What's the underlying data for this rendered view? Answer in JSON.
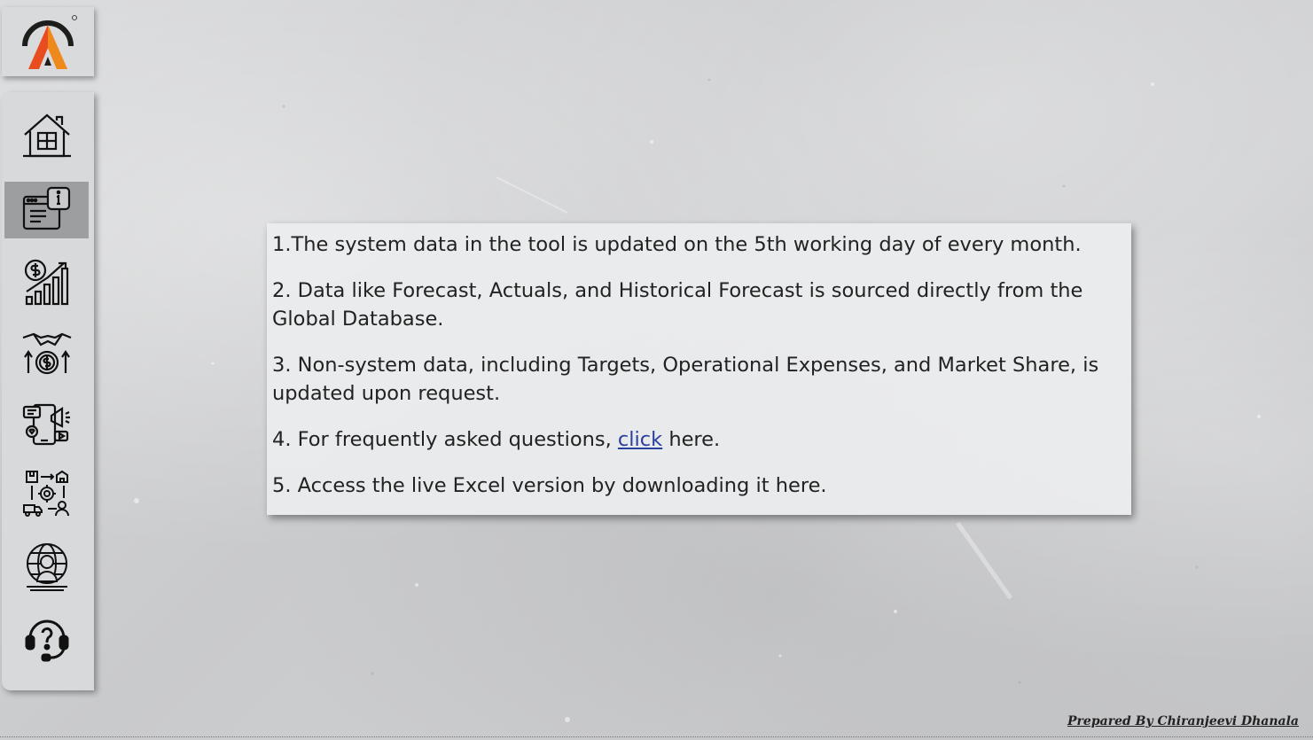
{
  "logo": {
    "brand_colors": [
      "#e84c1f",
      "#f29e1b",
      "#1d1d1b"
    ],
    "icon": "brand-logo-a"
  },
  "sidebar": {
    "items": [
      {
        "id": "home",
        "icon": "house-icon",
        "active": false
      },
      {
        "id": "info",
        "icon": "info-document-icon",
        "active": true
      },
      {
        "id": "finance",
        "icon": "dollar-growth-chart-icon",
        "active": false
      },
      {
        "id": "deal",
        "icon": "handshake-money-icon",
        "active": false
      },
      {
        "id": "marketing",
        "icon": "social-media-marketing-icon",
        "active": false
      },
      {
        "id": "logistics",
        "icon": "supply-chain-icon",
        "active": false
      },
      {
        "id": "global",
        "icon": "global-person-icon",
        "active": false
      },
      {
        "id": "help",
        "icon": "support-headset-icon",
        "active": false
      }
    ],
    "active_color": "#9d9ea0"
  },
  "info": {
    "line1": "1.The system data in the tool is updated on the 5th working day of every month.",
    "line2": "2. Data like Forecast, Actuals, and Historical Forecast is sourced directly from the Global Database.",
    "line3": "3. Non-system data, including Targets, Operational Expenses, and Market Share, is updated upon request.",
    "line4_prefix": "4. For frequently asked questions, ",
    "line4_link": "click",
    "line4_suffix": " here.",
    "line5": "5. Access the live Excel version by downloading it here."
  },
  "footer": {
    "credit": "Prepared By Chiranjeevi Dhanala"
  }
}
